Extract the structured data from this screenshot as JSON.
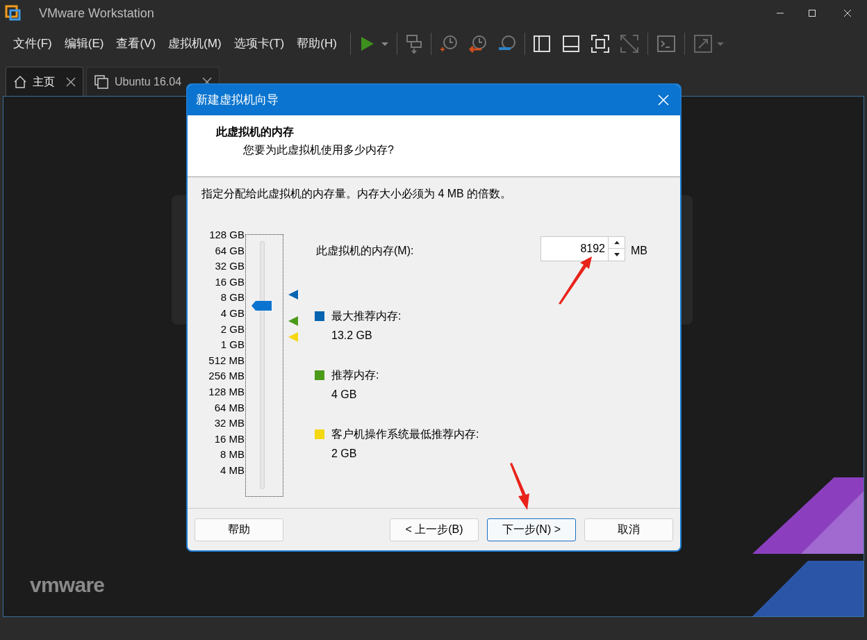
{
  "window": {
    "title": "VMware Workstation"
  },
  "menu": [
    "文件(F)",
    "编辑(E)",
    "查看(V)",
    "虚拟机(M)",
    "选项卡(T)",
    "帮助(H)"
  ],
  "tabs": [
    {
      "label": "主页",
      "kind": "home",
      "selected": true
    },
    {
      "label": "Ubuntu 16.04",
      "kind": "vm",
      "selected": false
    }
  ],
  "home_logo": "vmware",
  "dialog": {
    "title": "新建虚拟机向导",
    "heading": "此虚拟机的内存",
    "subheading": "您要为此虚拟机使用多少内存?",
    "instruction": "指定分配给此虚拟机的内存量。内存大小必须为 4 MB 的倍数。",
    "slider": {
      "ticks": [
        "128 GB",
        "64 GB",
        "32 GB",
        "16 GB",
        "8 GB",
        "4 GB",
        "2 GB",
        "1 GB",
        "512 MB",
        "256 MB",
        "128 MB",
        "64 MB",
        "32 MB",
        "16 MB",
        "8 MB",
        "4 MB"
      ],
      "level": 0.733,
      "markers": [
        {
          "color": "#0563b0",
          "level": 0.78
        },
        {
          "color": "#4c9a1a",
          "level": 0.667
        },
        {
          "color": "#f5d712",
          "level": 0.6
        }
      ]
    },
    "memory_label": "此虚拟机的内存(M):",
    "memory_value": "8192",
    "unit": "MB",
    "recommendations": [
      {
        "label": "最大推荐内存:",
        "value": "13.2 GB",
        "color": "#0563b0"
      },
      {
        "label": "推荐内存:",
        "value": "4 GB",
        "color": "#4c9a1a"
      },
      {
        "label": "客户机操作系统最低推荐内存:",
        "value": "2 GB",
        "color": "#f5d712"
      }
    ],
    "buttons": [
      {
        "label": "帮助",
        "focused": false
      },
      {
        "label": "< 上一步(B)",
        "focused": false
      },
      {
        "label": "下一步(N) >",
        "focused": true
      },
      {
        "label": "取消",
        "focused": false
      }
    ]
  }
}
